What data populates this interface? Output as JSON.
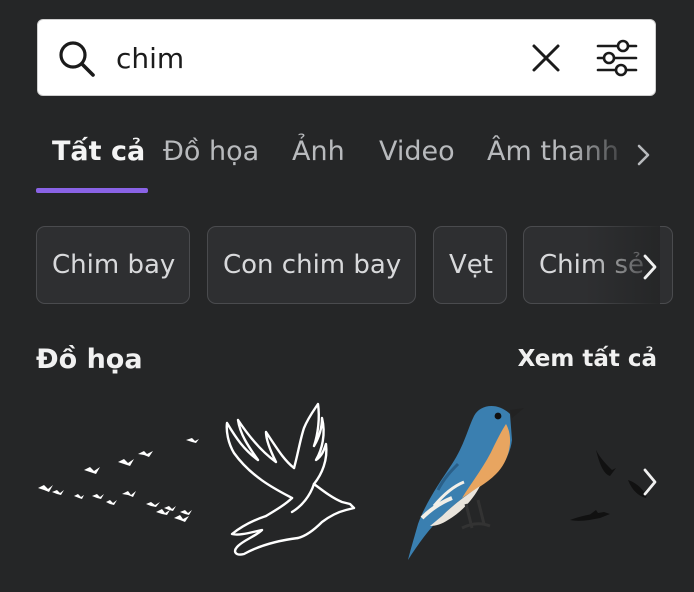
{
  "search": {
    "value": "chim",
    "icons": {
      "search": "search-icon",
      "clear": "close-icon",
      "filter": "filter-sliders-icon"
    }
  },
  "tabs": [
    {
      "label": "Tất cả",
      "active": true
    },
    {
      "label": "Đồ họa",
      "active": false
    },
    {
      "label": "Ảnh",
      "active": false
    },
    {
      "label": "Video",
      "active": false
    },
    {
      "label": "Âm thanh",
      "active": false
    }
  ],
  "chips": [
    {
      "label": "Chim bay"
    },
    {
      "label": "Con chim bay"
    },
    {
      "label": "Vẹt"
    },
    {
      "label": "Chim sẻ"
    }
  ],
  "section": {
    "title": "Đồ họa",
    "see_all": "Xem tất cả"
  },
  "colors": {
    "background": "#252627",
    "accent": "#8a63e6",
    "chip_bg": "#2e2f31"
  }
}
